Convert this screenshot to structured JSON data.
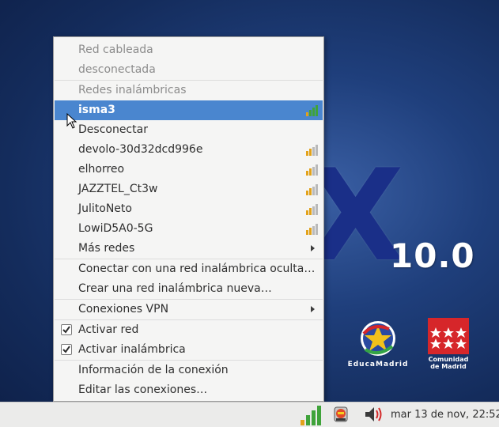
{
  "desktop": {
    "brand_letter": "X",
    "brand_version": "10.0",
    "educamadrid_label": "EducaMadrid",
    "comunidad_label_line1": "Comunidad",
    "comunidad_label_line2": "de Madrid"
  },
  "menu": {
    "items": [
      {
        "label": "Red cableada",
        "state": "disabled"
      },
      {
        "label": "desconectada",
        "state": "disabled"
      },
      {
        "label": "Redes inalámbricas",
        "state": "disabled"
      },
      {
        "label": "isma3",
        "state": "selected",
        "signal": "full"
      },
      {
        "label": "Desconectar"
      },
      {
        "label": "devolo-30d32dcd996e",
        "signal": "low"
      },
      {
        "label": "elhorreo",
        "signal": "low"
      },
      {
        "label": "JAZZTEL_Ct3w",
        "signal": "low"
      },
      {
        "label": "JulitoNeto",
        "signal": "low"
      },
      {
        "label": "LowiD5A0-5G",
        "signal": "low"
      },
      {
        "label": "Más redes",
        "submenu": true
      },
      {
        "label": "Conectar con una red inalámbrica oculta…"
      },
      {
        "label": "Crear una red inalámbrica nueva…"
      },
      {
        "label": "Conexiones VPN",
        "submenu": true
      },
      {
        "label": "Activar red",
        "checked": true
      },
      {
        "label": "Activar inalámbrica",
        "checked": true
      },
      {
        "label": "Información de la conexión"
      },
      {
        "label": "Editar las conexiones…"
      }
    ]
  },
  "taskbar": {
    "clock": "mar 13 de nov, 22:52",
    "icons": [
      "wifi-signal-icon",
      "update-notifier-icon",
      "volume-icon"
    ]
  },
  "colors": {
    "selection": "#4a86cf",
    "menu_bg": "#f5f5f4",
    "signal_green": "#3fa33a",
    "signal_yellow": "#e2a21a"
  }
}
